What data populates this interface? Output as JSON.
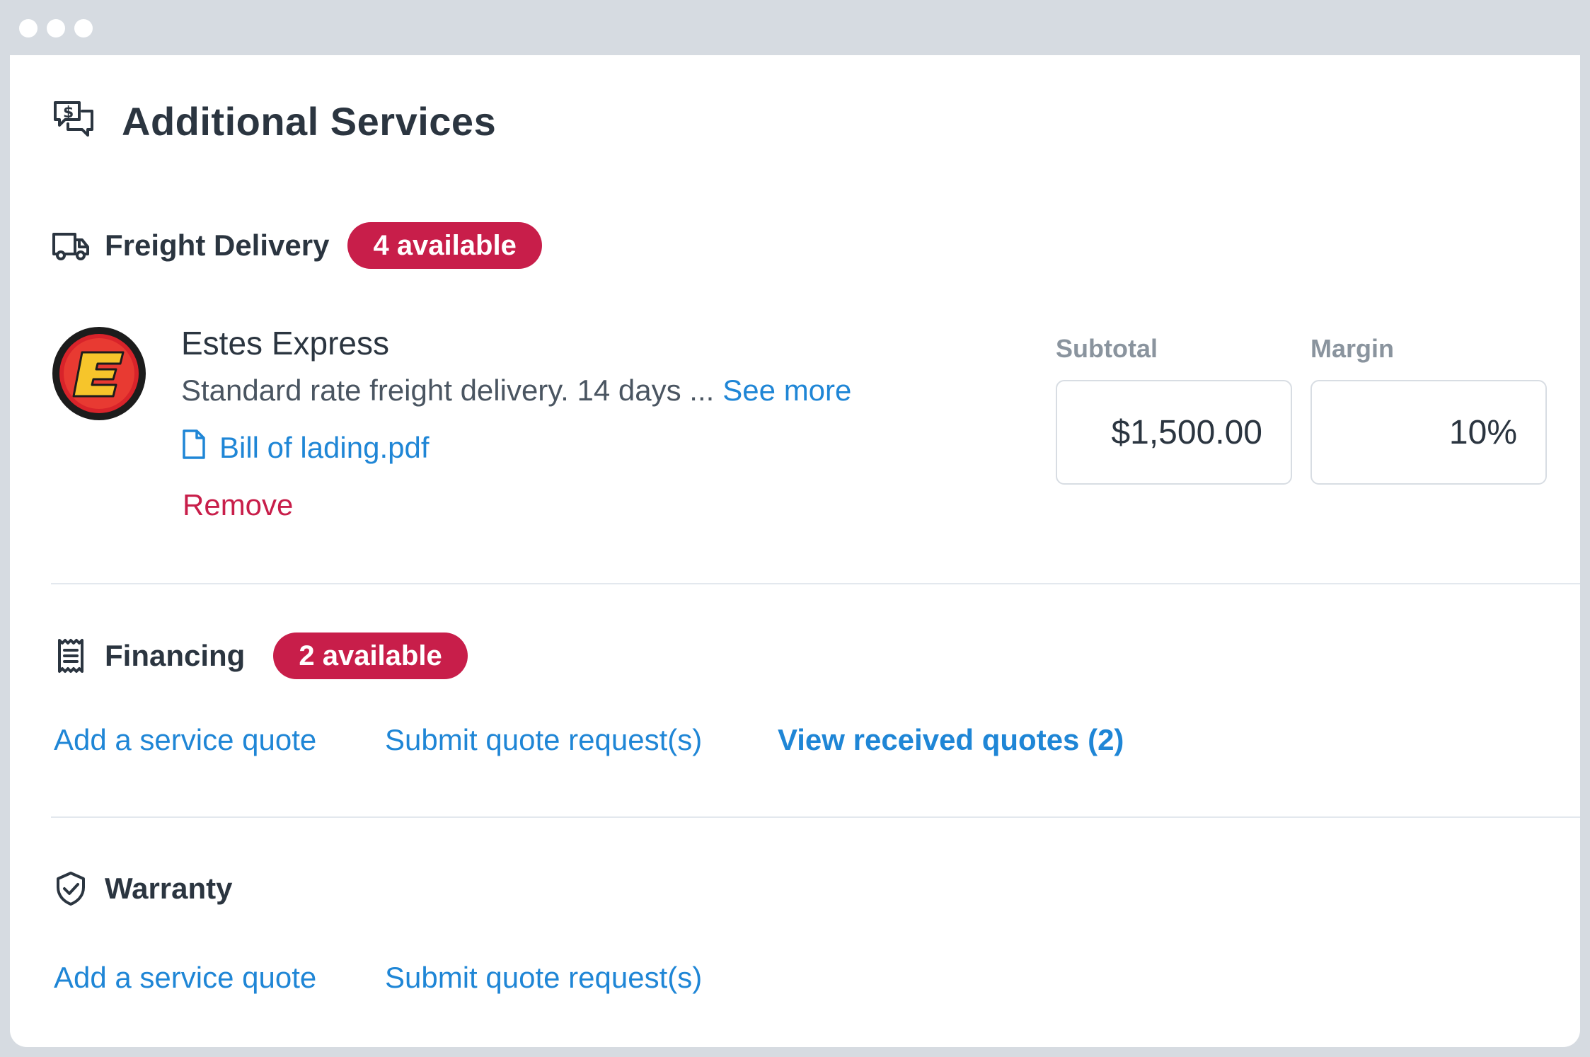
{
  "window": {
    "dots": [
      "close",
      "minimize",
      "maximize"
    ]
  },
  "header": {
    "title": "Additional Services",
    "icon": "quote-bubbles-icon"
  },
  "freight": {
    "title": "Freight Delivery",
    "badge": "4 available",
    "icon": "truck-icon",
    "vendor": {
      "name": "Estes Express",
      "description": "Standard rate freight delivery. 14 days ...",
      "see_more": "See more",
      "file": "Bill of lading.pdf",
      "remove": "Remove",
      "logo": "E"
    },
    "subtotal": {
      "label": "Subtotal",
      "value": "$1,500.00"
    },
    "margin": {
      "label": "Margin",
      "value": "10%"
    }
  },
  "financing": {
    "title": "Financing",
    "badge": "2 available",
    "icon": "receipt-icon",
    "add_quote": "Add a service quote",
    "submit_request": "Submit quote request(s)",
    "view_received": "View received quotes (2)"
  },
  "warranty": {
    "title": "Warranty",
    "icon": "shield-check-icon",
    "add_quote": "Add a service quote",
    "submit_request": "Submit quote request(s)"
  },
  "colors": {
    "accent": "#1f86d6",
    "badge": "#c81e4a",
    "frame": "#d6dbe1",
    "text": "#2b3540"
  }
}
